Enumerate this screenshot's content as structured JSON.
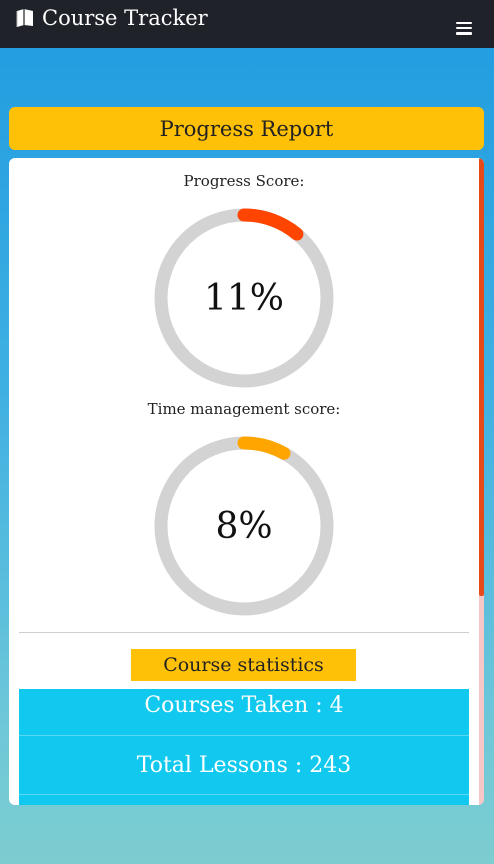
{
  "navbar": {
    "brand_icon": "book-icon",
    "title": "Course Tracker",
    "menu_icon": "hamburger-menu-icon"
  },
  "report": {
    "header": "Progress Report",
    "progress": {
      "label": "Progress Score:",
      "value_text": "11%",
      "value": 11,
      "color": "#ff4500"
    },
    "time_management": {
      "label": "Time management score:",
      "value_text": "8%",
      "value": 8,
      "color": "#ffa500"
    },
    "track_color": "#d3d3d3",
    "statistics": {
      "title": "Course statistics",
      "items": [
        "Courses Taken : 4",
        "Total Lessons : 243",
        ""
      ]
    }
  },
  "colors": {
    "accent_yellow": "#ffc107",
    "stat_cyan": "#11c9ee",
    "navbar_dark": "#1f2228"
  }
}
